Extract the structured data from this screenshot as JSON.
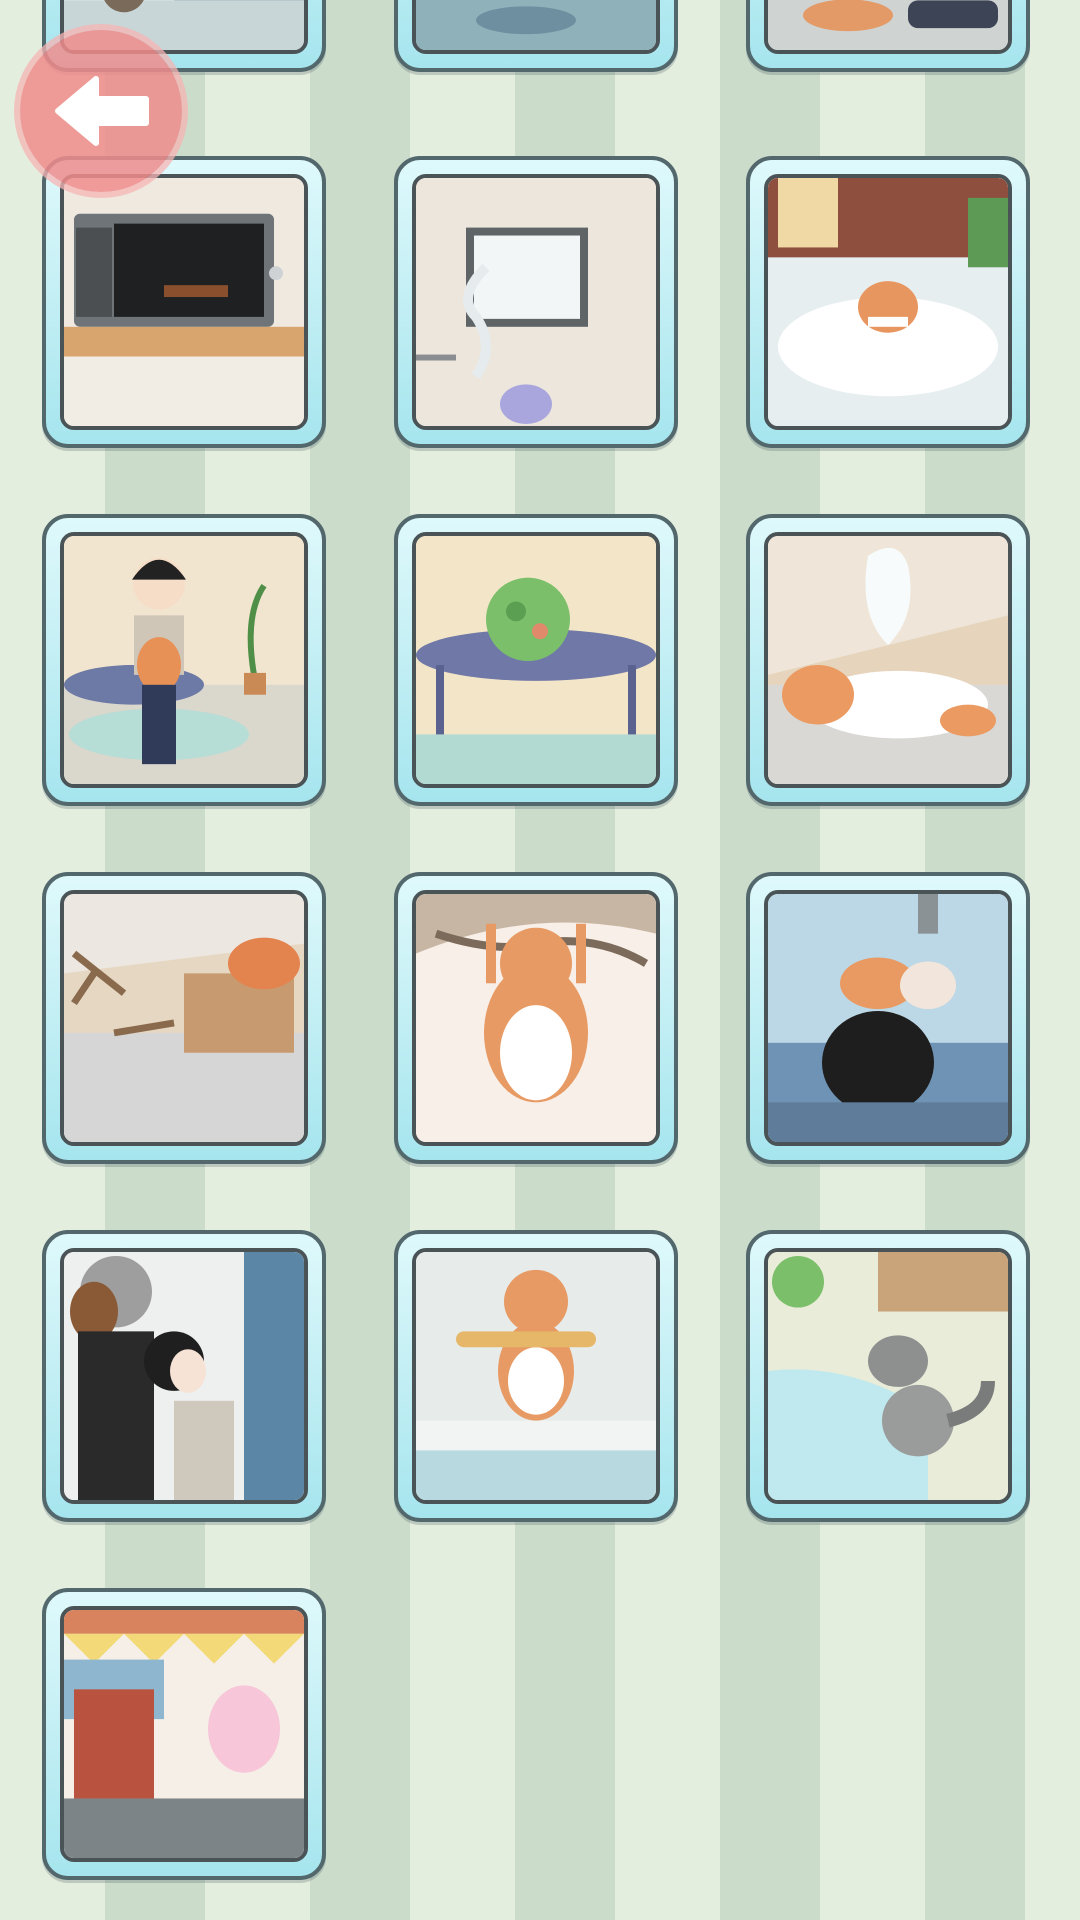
{
  "screen": "scene-gallery",
  "back_button": {
    "icon": "arrow-left-icon"
  },
  "colors": {
    "stripe_light": "#e4eedf",
    "stripe_dark": "#cbdccb",
    "card_fill": "#a6e5ee",
    "card_border": "#53686c",
    "back_button": "#f08c8c"
  },
  "gallery": {
    "items": [
      {
        "scene": "partial-top-left",
        "state": "unlocked"
      },
      {
        "scene": "partial-top-middle",
        "state": "unlocked"
      },
      {
        "scene": "partial-top-right",
        "state": "unlocked"
      },
      {
        "scene": "microwave-chocolate",
        "state": "unlocked"
      },
      {
        "scene": "steaming-kettle-window",
        "state": "unlocked"
      },
      {
        "scene": "cat-in-snow-cloud",
        "state": "unlocked"
      },
      {
        "scene": "boy-holding-cat",
        "state": "unlocked"
      },
      {
        "scene": "green-fluff-on-table",
        "state": "unlocked"
      },
      {
        "scene": "cat-ghost-sleeping",
        "state": "unlocked"
      },
      {
        "scene": "cat-in-box-branches",
        "state": "unlocked"
      },
      {
        "scene": "cat-hanging-branch",
        "state": "unlocked"
      },
      {
        "scene": "claw-machine-cat",
        "state": "unlocked"
      },
      {
        "scene": "man-and-crying-girl",
        "state": "unlocked"
      },
      {
        "scene": "cat-with-towel",
        "state": "unlocked"
      },
      {
        "scene": "raccoon-by-pond",
        "state": "unlocked"
      },
      {
        "scene": "cotton-candy-vendor",
        "state": "unlocked"
      }
    ]
  }
}
